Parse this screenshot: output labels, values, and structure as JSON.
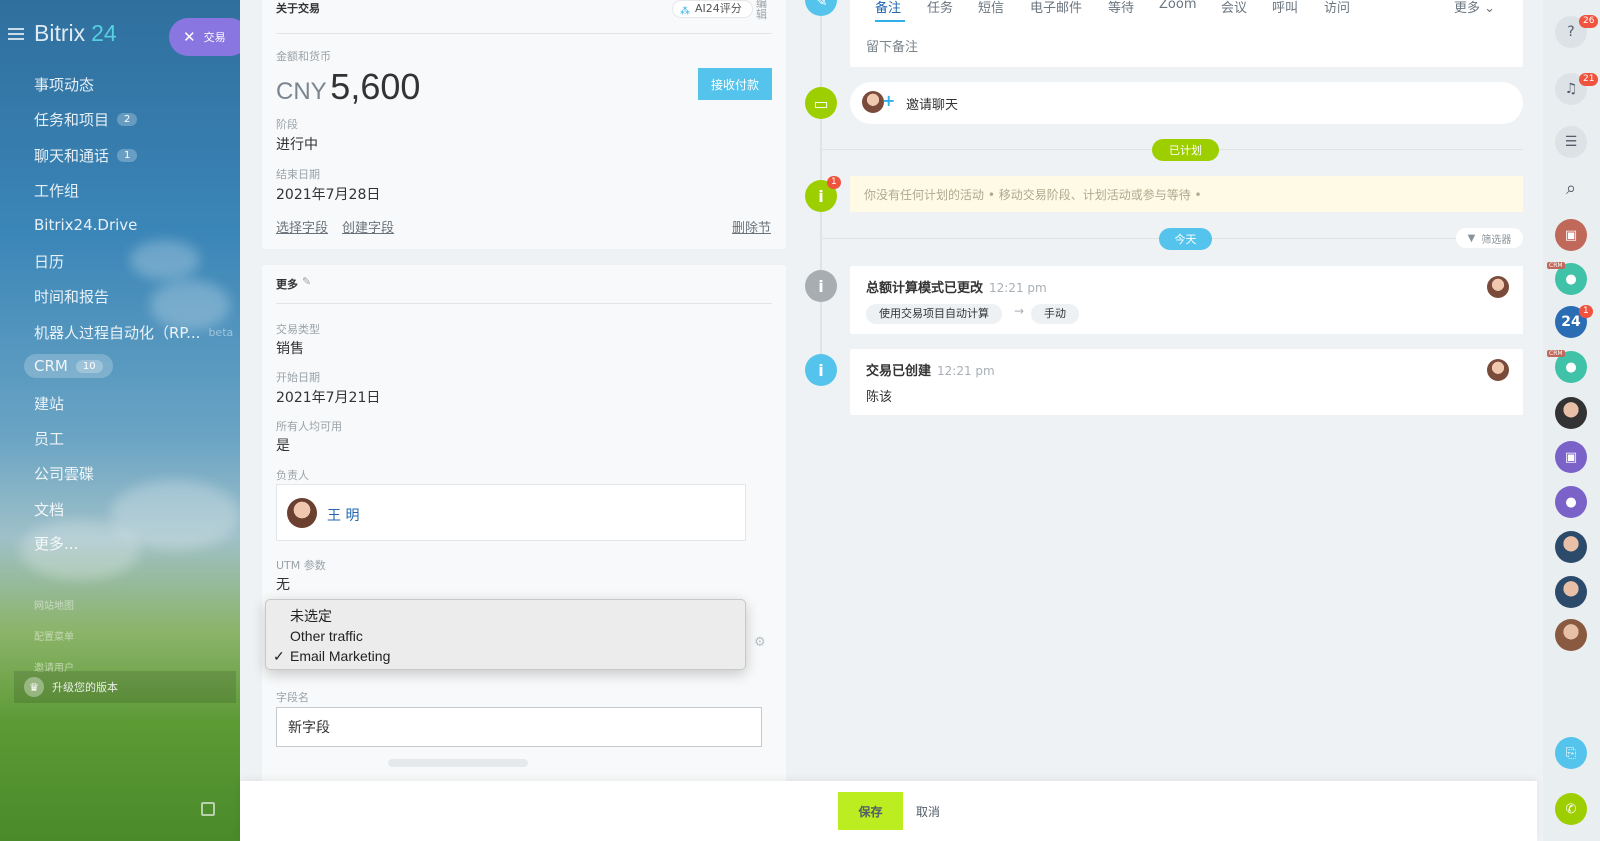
{
  "sidebar": {
    "logo": "Bitrix",
    "logo_num": "24",
    "deal_pill": "交易",
    "items": [
      {
        "label": "事项动态",
        "count": ""
      },
      {
        "label": "任务和项目",
        "count": "2"
      },
      {
        "label": "聊天和通话",
        "count": "1"
      },
      {
        "label": "工作组",
        "count": ""
      },
      {
        "label": "Bitrix24.Drive",
        "count": ""
      },
      {
        "label": "日历",
        "count": ""
      },
      {
        "label": "时间和报告",
        "count": ""
      },
      {
        "label": "机器人过程自动化（RP...",
        "count": "",
        "badge": "beta"
      },
      {
        "label": "CRM",
        "count": "10"
      },
      {
        "label": "建站",
        "count": ""
      },
      {
        "label": "员工",
        "count": ""
      },
      {
        "label": "公司雲碟",
        "count": ""
      },
      {
        "label": "文档",
        "count": ""
      },
      {
        "label": "更多...",
        "count": ""
      }
    ],
    "small_links": [
      "网站地图",
      "配置菜单",
      "邀请用户"
    ],
    "upgrade": "升级您的版本"
  },
  "about": {
    "title": "关于交易",
    "ai_score": "AI24评分",
    "edit": "编辑",
    "amount_label": "金额和货币",
    "currency": "CNY",
    "amount": "5,600",
    "receive_payment": "接收付款",
    "stage_label": "阶段",
    "stage": "进行中",
    "end_date_label": "结束日期",
    "end_date": "2021年7月28日",
    "select_field": "选择字段",
    "create_field": "创建字段",
    "delete_section": "删除节"
  },
  "more": {
    "title": "更多",
    "deal_type_label": "交易类型",
    "deal_type": "销售",
    "start_date_label": "开始日期",
    "start_date": "2021年7月21日",
    "available_label": "所有人均可用",
    "available": "是",
    "responsible_label": "负责人",
    "responsible": "王 明",
    "utm_label": "UTM 参数",
    "utm": "无",
    "field_name_label": "字段名",
    "field_name_value": "新字段"
  },
  "select_popup": {
    "options": [
      "未选定",
      "Other traffic",
      "Email Marketing"
    ],
    "checked": "✓"
  },
  "timeline": {
    "tabs": [
      "备注",
      "任务",
      "短信",
      "电子邮件",
      "等待",
      "Zoom",
      "会议",
      "呼叫",
      "访问"
    ],
    "tab_more": "更多 ⌄",
    "note_placeholder": "留下备注",
    "invite_chat": "邀请聊天",
    "planned": "已计划",
    "empty_planned": "你没有任何计划的活动 • 移动交易阶段、计划活动或参与等待 •",
    "empty_badge": "1",
    "today": "今天",
    "filter": "筛选器",
    "events": [
      {
        "title": "总额计算模式已更改",
        "time": "12:21 pm",
        "from": "使用交易项目自动计算",
        "arrow": "→",
        "to": "手动"
      },
      {
        "title": "交易已创建",
        "time": "12:21 pm",
        "body": "陈该"
      }
    ]
  },
  "rail": {
    "help_badge": "26",
    "bell_badge": "21",
    "b24_label": "24",
    "b24_badge": "1",
    "crm_tag": "CRM"
  },
  "footer": {
    "save": "保存",
    "cancel": "取消"
  }
}
